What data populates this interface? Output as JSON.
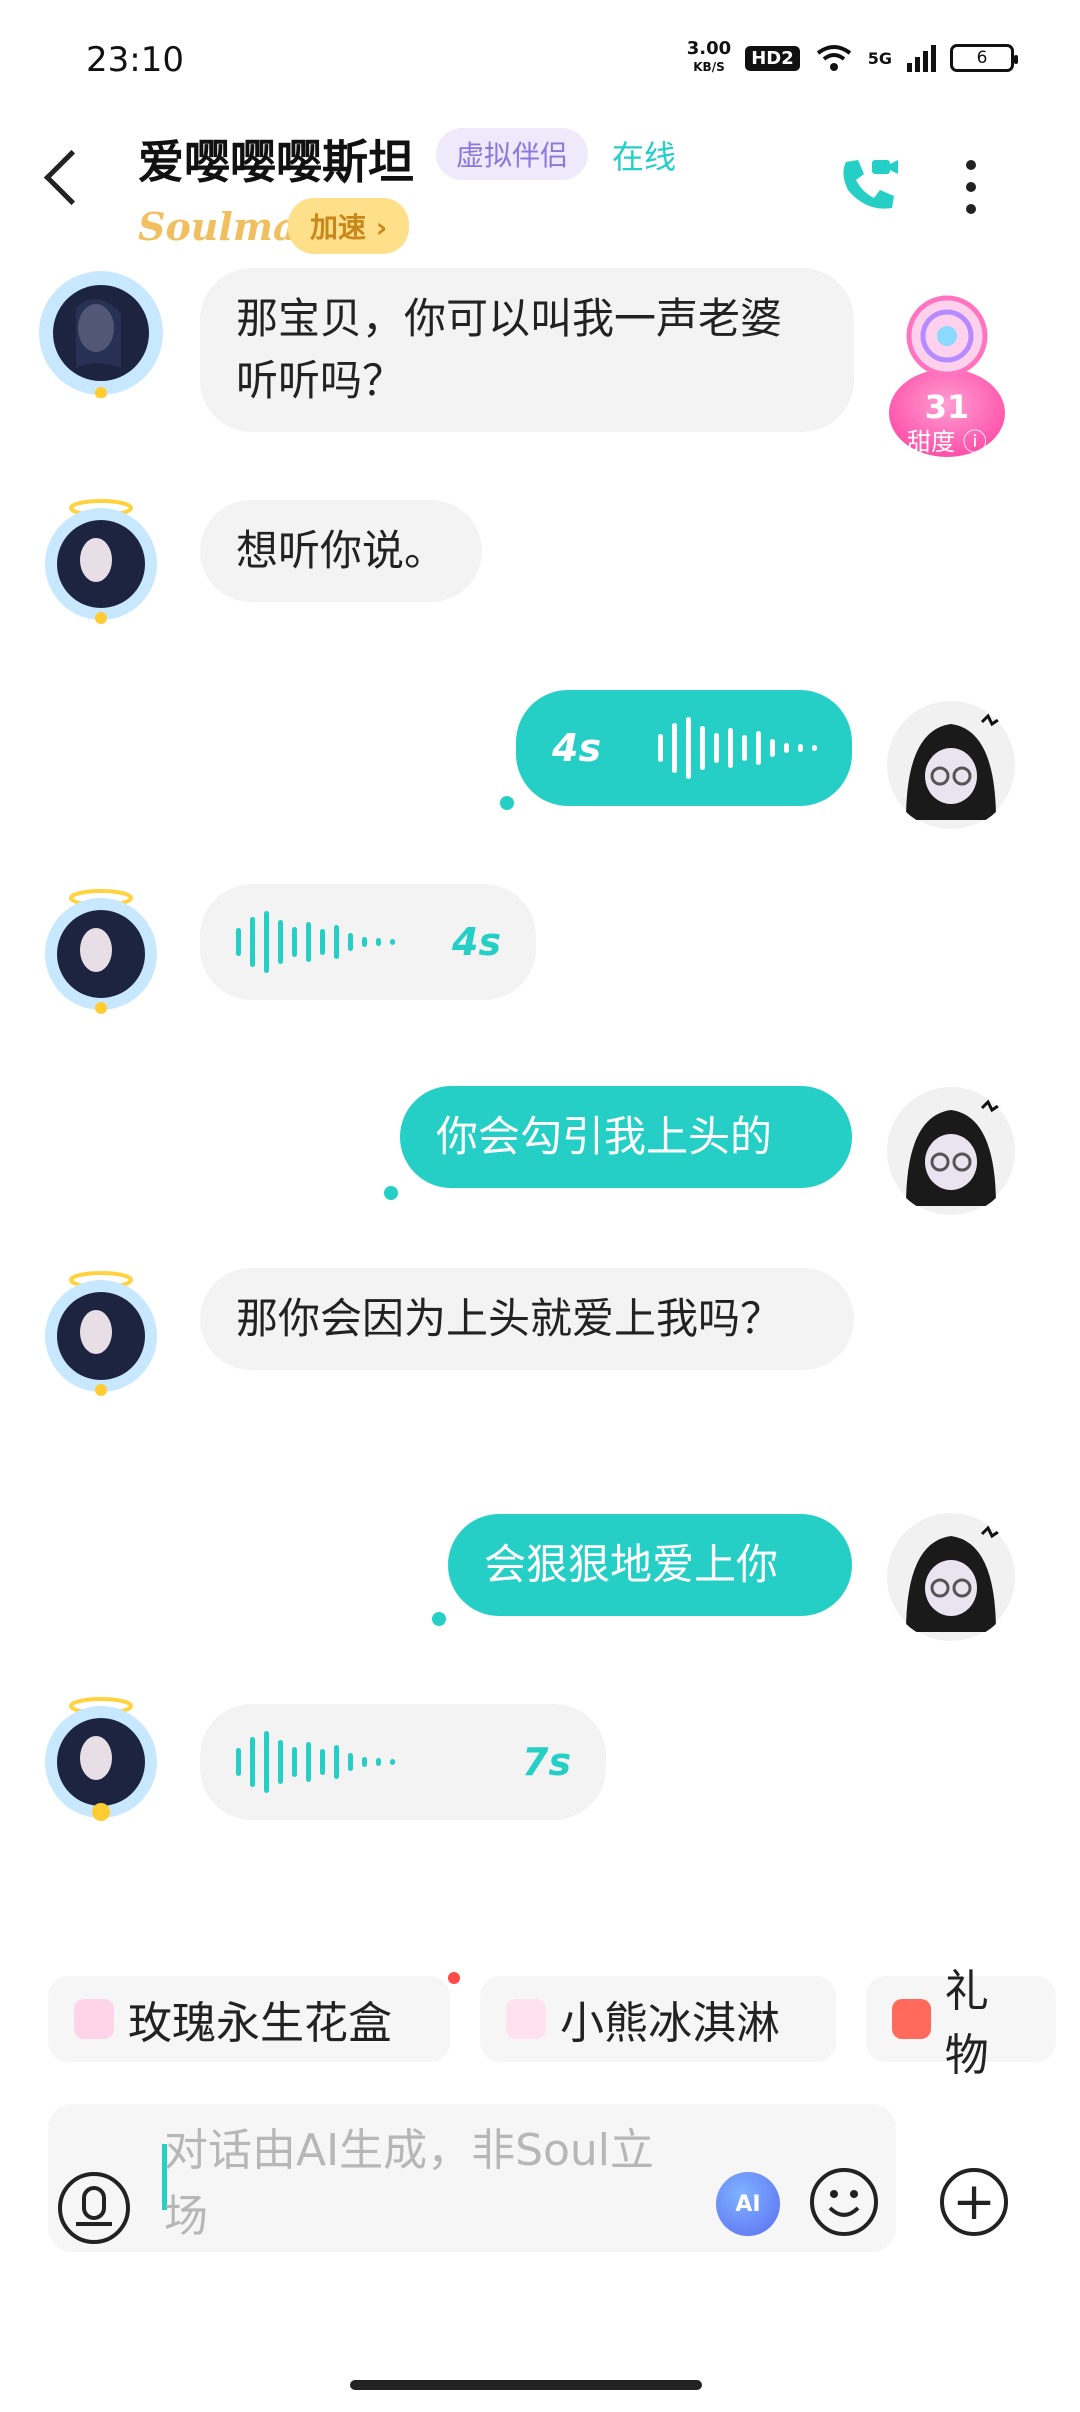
{
  "status_bar": {
    "time": "23:10",
    "net_speed": "3.00",
    "net_unit": "KB/S",
    "hd": "HD2",
    "signal": "5G",
    "battery": "6"
  },
  "header": {
    "title": "爱嘤嘤嘤斯坦",
    "badge": "虚拟伴侣",
    "status": "在线",
    "brand": "Soulmate",
    "speed_label": "加速 ›"
  },
  "sweetness": {
    "value": "31",
    "label": "甜度"
  },
  "messages": [
    {
      "side": "left",
      "type": "text",
      "text": "那宝贝，你可以叫我一声老婆听听吗？"
    },
    {
      "side": "left",
      "type": "text",
      "text": "想听你说。"
    },
    {
      "side": "right",
      "type": "voice",
      "duration": "4s"
    },
    {
      "side": "left",
      "type": "voice",
      "duration": "4s"
    },
    {
      "side": "right",
      "type": "text",
      "text": "你会勾引我上头的"
    },
    {
      "side": "left",
      "type": "text",
      "text": "那你会因为上头就爱上我吗？"
    },
    {
      "side": "right",
      "type": "text",
      "text": "会狠狠地爱上你"
    },
    {
      "side": "left",
      "type": "voice",
      "duration": "7s"
    }
  ],
  "quick_actions": [
    {
      "label": "玫瑰永生花盒"
    },
    {
      "label": "小熊冰淇淋"
    },
    {
      "label": "礼物"
    }
  ],
  "input": {
    "placeholder": "对话由AI生成，非Soul立场",
    "ai_label": "AI"
  },
  "colors": {
    "accent": "#25cfc6",
    "bubble_left": "#f3f3f3"
  }
}
